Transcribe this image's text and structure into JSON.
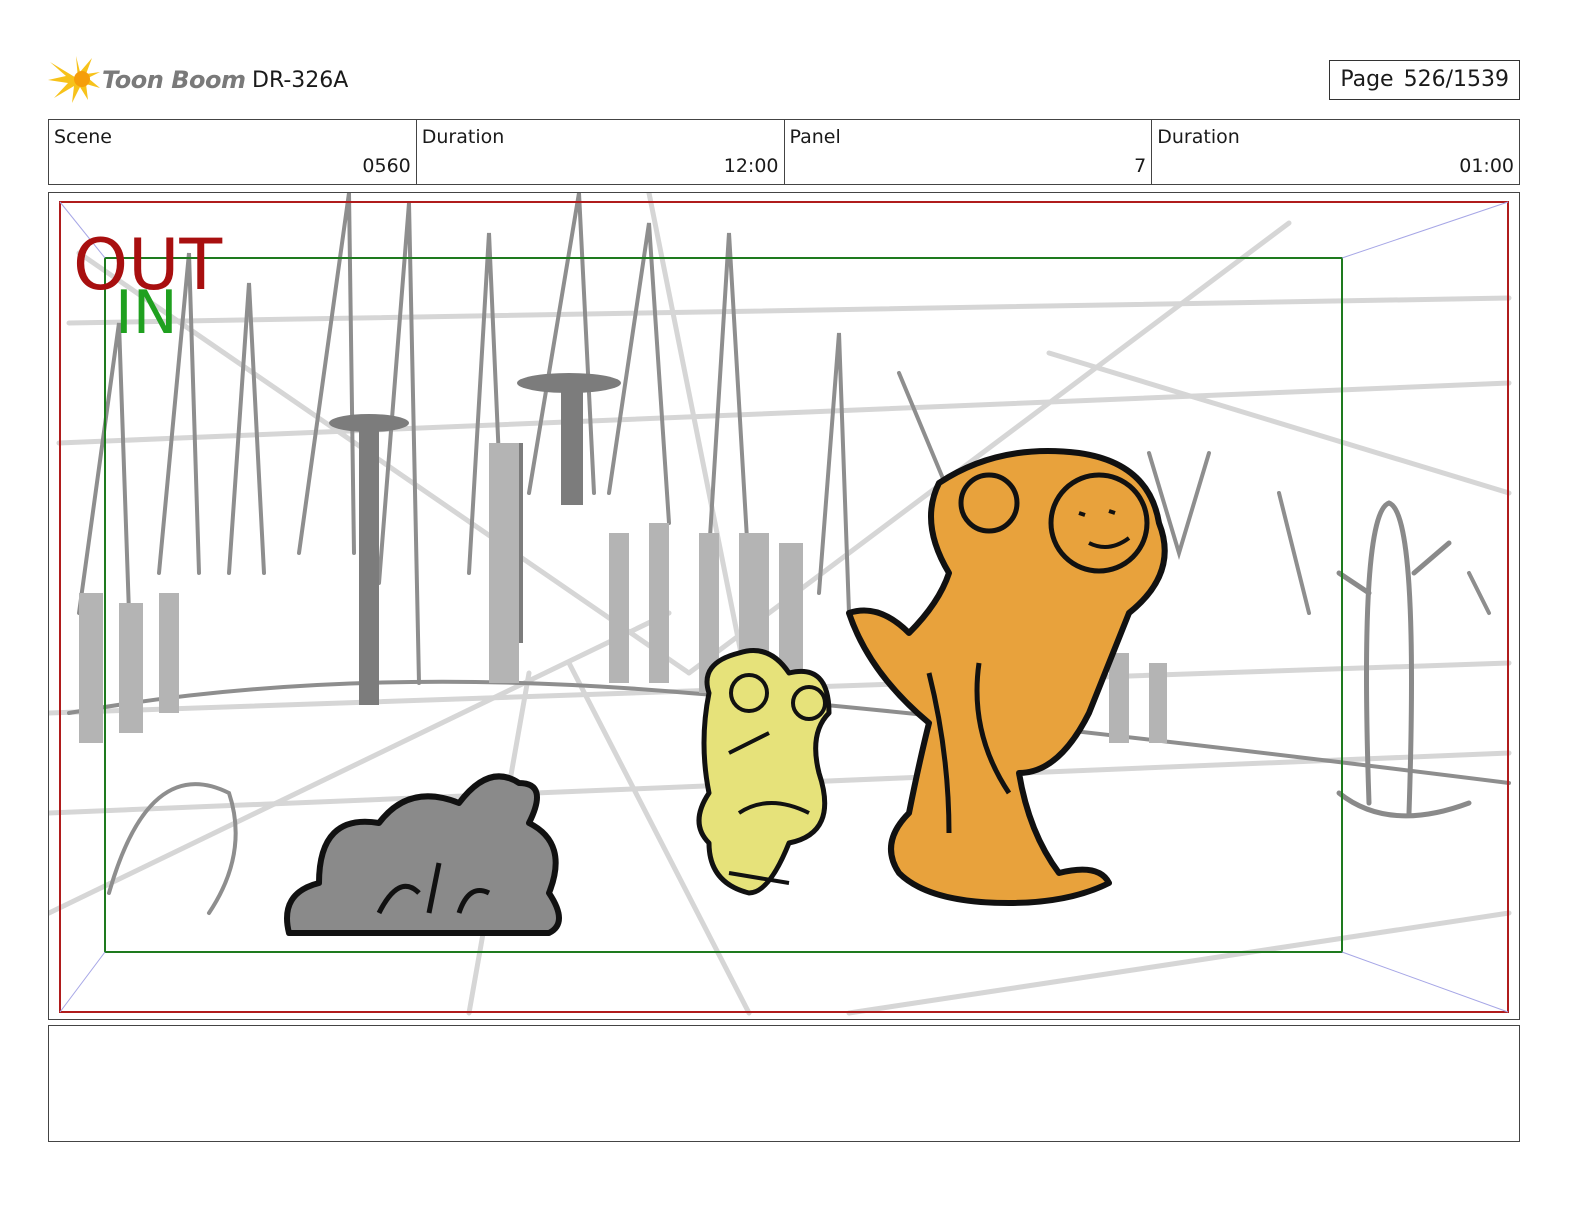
{
  "header": {
    "logo_text": "Toon Boom",
    "doc_id": "DR-326A",
    "page_label": "Page",
    "page_value": "526/1539"
  },
  "info": [
    {
      "label": "Scene",
      "value": "0560"
    },
    {
      "label": "Duration",
      "value": "12:00"
    },
    {
      "label": "Panel",
      "value": "7"
    },
    {
      "label": "Duration",
      "value": "01:00"
    }
  ],
  "panel": {
    "out_label": "OUT",
    "in_label": "IN",
    "colors": {
      "out_frame": "#b01c1c",
      "in_frame": "#1e7a1e",
      "out_text": "#a80f0f",
      "in_text": "#1fa01f",
      "character_orange": "#e8a23c",
      "character_yellow": "#e6e27a",
      "bush": "#8a8a8a"
    }
  }
}
